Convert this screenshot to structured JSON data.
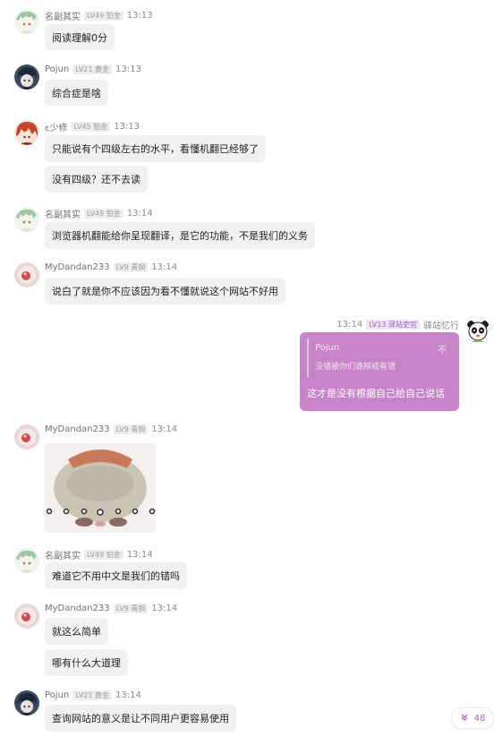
{
  "messages": [
    {
      "user": "名副其实",
      "level": "LV49 铂金",
      "time": "13:13",
      "avatar": "green-hair-avatar",
      "bubbles": [
        "阅读理解0分"
      ]
    },
    {
      "user": "Pojun",
      "level": "LV21 黄金",
      "time": "13:13",
      "avatar": "dark-hair-avatar",
      "bubbles": [
        "综合症是啥"
      ]
    },
    {
      "user": "ε少修",
      "level": "LV45 铂金",
      "time": "13:13",
      "avatar": "red-hair-avatar",
      "bubbles": [
        "只能说有个四级左右的水平，看懂机翻已经够了",
        "没有四级？还不去读"
      ]
    },
    {
      "user": "名副其实",
      "level": "LV49 铂金",
      "time": "13:14",
      "avatar": "green-hair-avatar",
      "bubbles": [
        "浏览器机翻能给你呈现翻译，是它的功能，不是我们的义务"
      ]
    },
    {
      "user": "MyDandan233",
      "level": "LV9 青铜",
      "time": "13:14",
      "avatar": "pink-avatar",
      "bubbles": [
        "说白了就是你不应该因为看不懂就说这个网站不好用"
      ]
    },
    {
      "user": "MyDandan233",
      "level": "LV9 青铜",
      "time": "13:14",
      "avatar": "pink-avatar",
      "bubbles": []
    },
    {
      "user": "名副其实",
      "level": "LV49 铂金",
      "time": "13:14",
      "avatar": "green-hair-avatar",
      "bubbles": [
        "难道它不用中文是我们的错吗"
      ]
    },
    {
      "user": "MyDandan233",
      "level": "LV9 青铜",
      "time": "13:14",
      "avatar": "pink-avatar",
      "bubbles": [
        "就这么简单",
        "哪有什么大道理"
      ]
    },
    {
      "user": "Pojun",
      "level": "LV21 黄金",
      "time": "13:14",
      "avatar": "dark-hair-avatar",
      "bubbles": [
        "查询网站的意义是让不同用户更容易使用"
      ]
    }
  ],
  "self_message": {
    "user": "驿站忆行",
    "level": "LV13 驿站吏官",
    "time": "13:14",
    "avatar": "panda-avatar",
    "quote_name": "Pojun",
    "quote_text": "没错被你们诡辩成有错",
    "quote_close": "不",
    "text": "这才是没有根据自己给自己说话"
  },
  "jump_button": {
    "count": "48",
    "icon": "double-chevron-down-icon"
  },
  "colors": {
    "self_bubble": "#c884c8",
    "bubble": "#f1f1f1",
    "accent": "#b45ac8"
  }
}
